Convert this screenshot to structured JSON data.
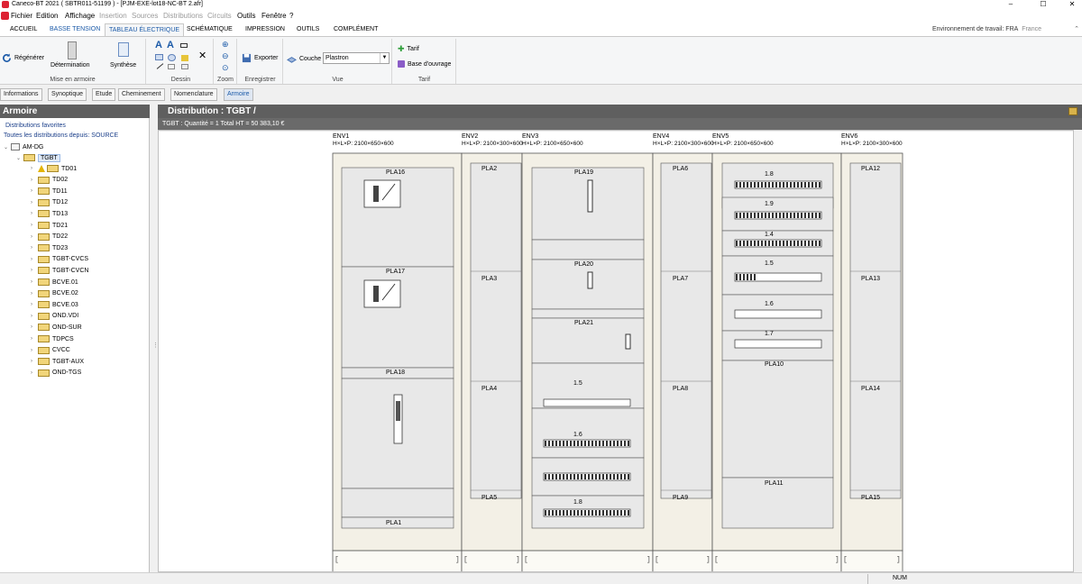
{
  "titlebar": {
    "title": "Caneco-BT 2021 ( SBTR011-51199 ) - [PJM-EXE-lot18-NC-BT 2.afr]",
    "min": "–",
    "max": "☐",
    "close": "✕"
  },
  "menu": [
    {
      "label": "Fichier",
      "enabled": true
    },
    {
      "label": "Edition",
      "enabled": true
    },
    {
      "label": "Affichage",
      "enabled": true
    },
    {
      "label": "Insertion",
      "enabled": false
    },
    {
      "label": "Sources",
      "enabled": false
    },
    {
      "label": "Distributions",
      "enabled": false
    },
    {
      "label": "Circuits",
      "enabled": false
    },
    {
      "label": "Outils",
      "enabled": true
    },
    {
      "label": "Fenêtre",
      "enabled": true
    },
    {
      "label": "?",
      "enabled": true
    }
  ],
  "ribbon_tabs": [
    "ACCUEIL",
    "BASSE TENSION",
    "TABLEAU ÉLECTRIQUE",
    "SCHÉMATIQUE",
    "IMPRESSION",
    "OUTILS",
    "COMPLÉMENT"
  ],
  "active_ribbon_tab": 2,
  "environment": "Environnement de travail: FRA",
  "country": "France",
  "ribbon": {
    "regenerer": "Régénérer",
    "determination": "Détermination",
    "synthese": "Synthèse",
    "mise_en_armoire": "Mise en armoire",
    "dessin": "Dessin",
    "zoom": "Zoom",
    "exporter": "Exporter",
    "enregistrer": "Enregistrer",
    "couche_label": "Couche",
    "couche_value": "Plastron",
    "vue": "Vue",
    "tarif_btn": "Tarif",
    "base_ouvrage": "Base d'ouvrage",
    "tarif_group": "Tarif"
  },
  "subtabs": [
    "Informations",
    "Synoptique",
    "Etude",
    "Cheminement",
    "Nomenclature",
    "Armoire"
  ],
  "active_subtab": 5,
  "left_header": "Armoire",
  "right_header": "Distribution : TGBT /",
  "tree": {
    "favorites": "Distributions favorites",
    "all_from": "Toutes les distributions depuis: SOURCE",
    "root": "AM-DG",
    "selected": "TGBT",
    "children": [
      "TD01",
      "TD02",
      "TD11",
      "TD12",
      "TD13",
      "TD21",
      "TD22",
      "TD23",
      "TGBT-CVCS",
      "TGBT-CVCN",
      "BCVE.01",
      "BCVE.02",
      "BCVE.03",
      "OND.VDI",
      "OND-SUR",
      "TDPCS",
      "CVCC",
      "TGBT-AUX",
      "OND-TGS"
    ]
  },
  "info_bar": "TGBT : Quantité = 1    Total HT = 50 383,10 €",
  "enclosures": [
    {
      "name": "ENV1",
      "dims": "H×L×P: 2100×650×600"
    },
    {
      "name": "ENV2",
      "dims": "H×L×P: 2100×300×600"
    },
    {
      "name": "ENV3",
      "dims": "H×L×P: 2100×650×600"
    },
    {
      "name": "ENV4",
      "dims": "H×L×P: 2100×300×600"
    },
    {
      "name": "ENV5",
      "dims": "H×L×P: 2100×650×600"
    },
    {
      "name": "ENV6",
      "dims": "H×L×P: 2100×300×600"
    }
  ],
  "plates": {
    "env1": [
      "PLA16",
      "PLA17",
      "PLA18",
      "PLA1"
    ],
    "env2": [
      "PLA2",
      "PLA3",
      "PLA4",
      "PLA5"
    ],
    "env3": [
      "PLA19",
      "PLA20",
      "PLA21",
      "1.5",
      "1.6",
      "1.8"
    ],
    "env4": [
      "PLA6",
      "PLA7",
      "PLA8",
      "PLA9"
    ],
    "env5": [
      "1.8",
      "1.9",
      "1.4",
      "1.5",
      "1.6",
      "1.7",
      "PLA10",
      "PLA11"
    ],
    "env6": [
      "PLA12",
      "PLA13",
      "PLA14",
      "PLA15"
    ]
  },
  "status": {
    "num": "NUM"
  },
  "colors": {
    "accent": "#1b5aa8",
    "header": "#5f5f5f",
    "cabinet_fill": "#f3f0e6",
    "plate_fill": "#e8e8e8",
    "folder": "#f1d57a"
  }
}
